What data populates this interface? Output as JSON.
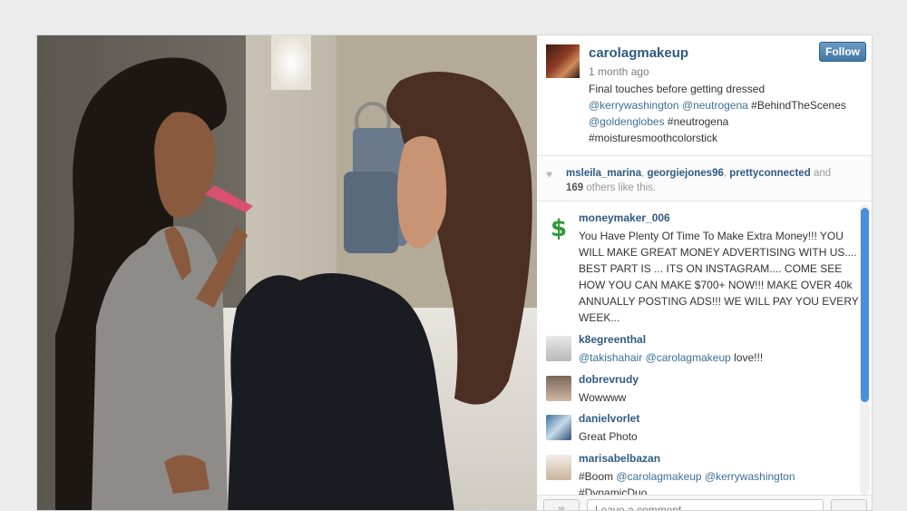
{
  "post": {
    "username": "carolagmakeup",
    "timestamp": "1 month ago",
    "follow_label": "Follow",
    "caption": {
      "text": "Final touches before getting dressed",
      "mention1": "@kerrywashington",
      "mention2": "@neutrogena",
      "tag1": "#BehindTheScenes",
      "mention3": "@goldenglobes",
      "tag2": "#neutrogena",
      "tag3": "#moisturesmoothcolorstick"
    }
  },
  "likes": {
    "user1": "msleila_marina",
    "user2": "georgiejones96",
    "user3": "prettyconnected",
    "and": "and",
    "count": "169",
    "suffix": "others like this."
  },
  "comments": [
    {
      "username": "moneymaker_006",
      "text": "You Have Plenty Of Time To Make Extra Money!!! YOU WILL MAKE GREAT MONEY ADVERTISING WITH US.... BEST PART IS ... ITS ON INSTAGRAM.... COME SEE HOW YOU CAN MAKE $700+ NOW!!! MAKE OVER 40k ANNUALLY POSTING ADS!!! WE WILL PAY YOU EVERY WEEK..."
    },
    {
      "username": "k8egreenthal",
      "mention1": "@takishahair",
      "mention2": "@carolagmakeup",
      "text_end": "love!!!"
    },
    {
      "username": "dobrevrudy",
      "text": "Wowwww"
    },
    {
      "username": "danielvorlet",
      "text": "Great Photo"
    },
    {
      "username": "marisabelbazan",
      "tag1": "#Boom",
      "mention1": "@carolagmakeup",
      "mention2": "@kerrywashington",
      "tag2": "#DynamicDuo"
    }
  ],
  "input": {
    "placeholder": "Leave a comment..."
  },
  "more_label": "...",
  "colors": {
    "link": "#2f5a82",
    "follow_bg": "#4377a5",
    "scroll_thumb": "#4a8fd9",
    "page_bg": "#ececed"
  }
}
